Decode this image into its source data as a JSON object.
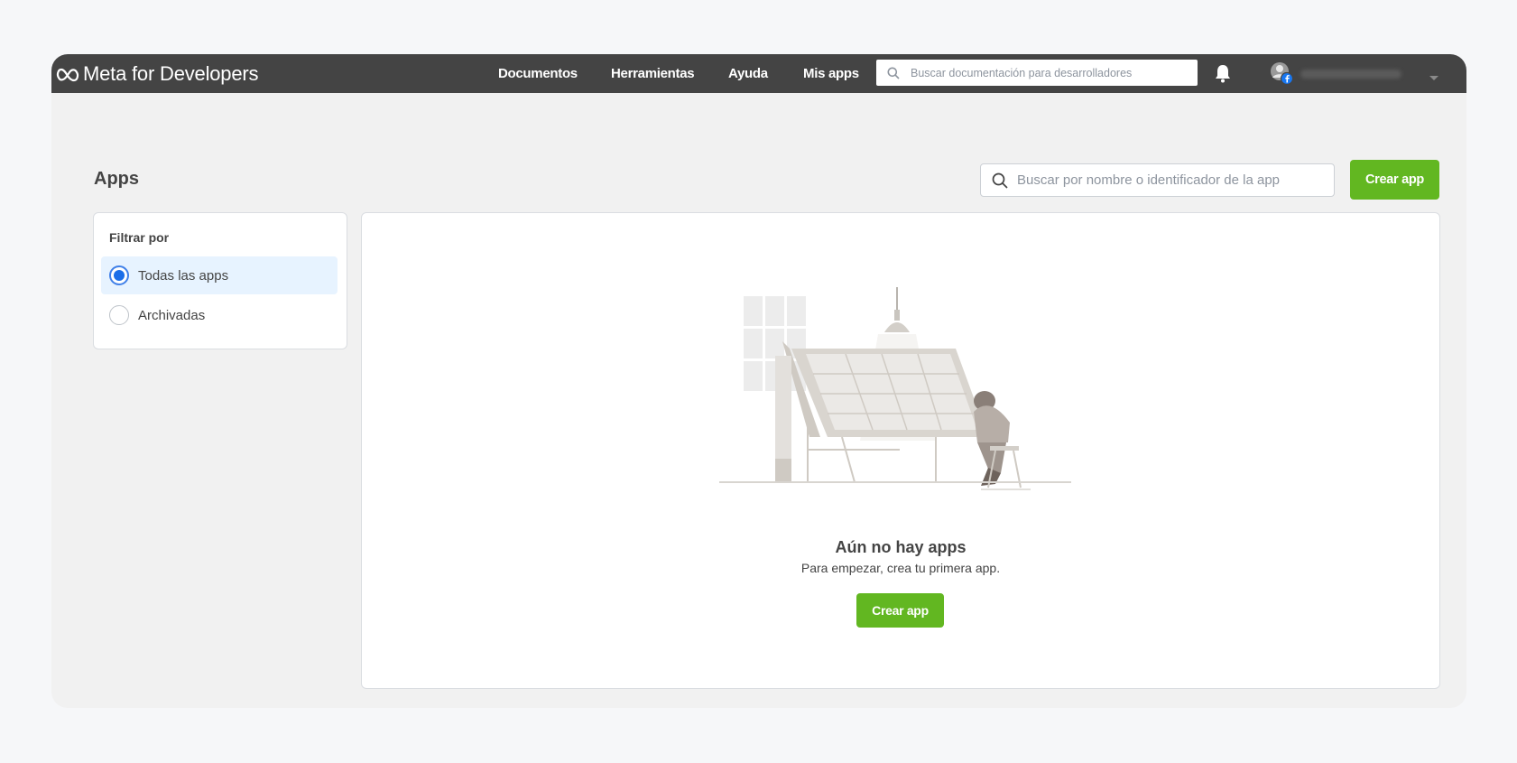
{
  "brand": {
    "logo_icon": "meta-infinity-logo",
    "name": "Meta for Developers"
  },
  "nav": {
    "items": [
      {
        "label": "Documentos"
      },
      {
        "label": "Herramientas"
      },
      {
        "label": "Ayuda"
      },
      {
        "label": "Mis apps"
      }
    ],
    "search_placeholder": "Buscar documentación para desarrolladores"
  },
  "header_icons": {
    "notifications": "bell-icon",
    "avatar": "avatar-with-facebook-badge",
    "account_menu": "chevron-down-icon"
  },
  "page": {
    "title": "Apps",
    "search_placeholder": "Buscar por nombre o identificador de la app",
    "create_button": "Crear app"
  },
  "filter": {
    "title": "Filtrar por",
    "options": [
      {
        "label": "Todas las apps",
        "selected": true
      },
      {
        "label": "Archivadas",
        "selected": false
      }
    ]
  },
  "empty_state": {
    "illustration": "person-at-drafting-table-illustration",
    "title": "Aún no hay apps",
    "subtitle": "Para empezar, crea tu primera app.",
    "button": "Crear app"
  },
  "colors": {
    "topbar": "#444444",
    "accent_green": "#62b721",
    "selected_bg": "#e7f3ff",
    "radio_blue": "#1b6ee8"
  }
}
